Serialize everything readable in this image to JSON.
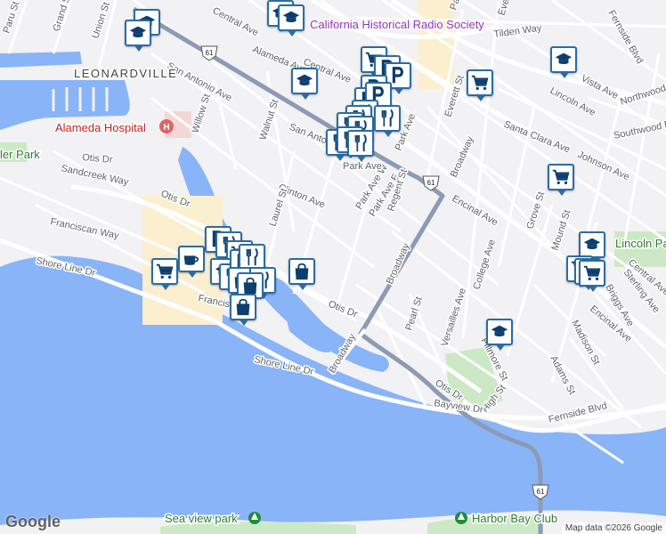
{
  "map": {
    "attribution": "Map data ©2026 Google",
    "logo_text": "Google",
    "colors": {
      "water": "#8ab4f8",
      "park": "#cde8c4",
      "land": "#f2f1f4",
      "highway": "#8c9bb5",
      "commercial": "#fbefcf"
    },
    "neighborhoods": [
      "LEONARDVILLE"
    ],
    "highway_shield": "61",
    "streets": [
      "Central Ave",
      "Tilden Way",
      "Paru St",
      "Grand St",
      "Union St",
      "San Antonio Ave",
      "Alameda Ave",
      "Willow St",
      "Walnut St",
      "Otis Dr",
      "Sandcreek Way",
      "Clinton Ave",
      "Laurel St",
      "Franciscan Way",
      "Shore Line Dr",
      "Park Ave W",
      "Park Ave E",
      "Regent St",
      "Broadway",
      "Encinal Ave",
      "Lincoln Ave",
      "Santa Clara Ave",
      "Johnson Ave",
      "Northwood Dr",
      "Southwood Dr",
      "Grove St",
      "Mound St",
      "College Ave",
      "Pearl St",
      "Versailles Ave",
      "Fillmore St",
      "Madison St",
      "Adams St",
      "Sterling Ave",
      "Briggs Ave",
      "High St",
      "Bayview Dr",
      "Fernside Blvd",
      "Park Ave",
      "Everett St",
      "Vista Ave",
      "Franciscan"
    ],
    "poi_labels": {
      "radio_society": "California Historical Radio Society",
      "hospital": "Alameda Hospital",
      "lincoln_park": "Lincoln Park",
      "sea_view_park": "Sea view park",
      "harbor_bay_club": "Harbor Bay Club",
      "ler_park": "ler Park"
    },
    "marker_icons": [
      "school-icon",
      "shopping-cart-icon",
      "restaurant-icon",
      "parking-icon",
      "cafe-icon",
      "shopping-bag-icon"
    ]
  }
}
